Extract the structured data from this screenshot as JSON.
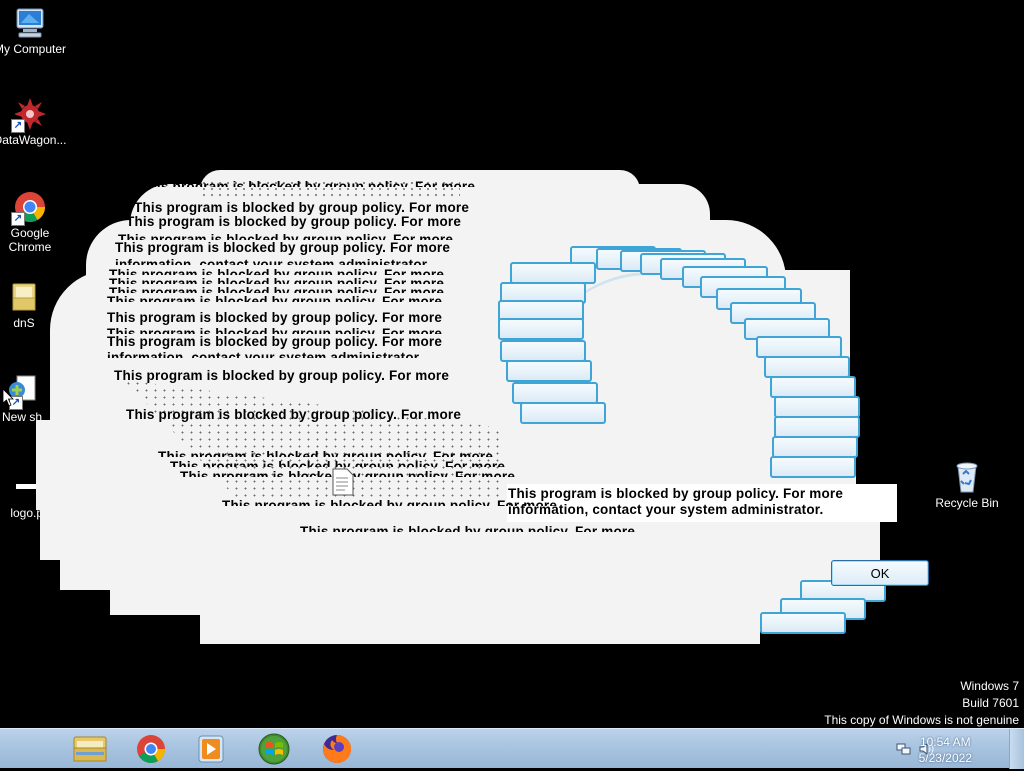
{
  "desktop_icons": [
    {
      "name": "my-computer",
      "label": "My Computer",
      "icon": "computer-icon"
    },
    {
      "name": "datawagon",
      "label": "DataWagon...",
      "icon": "datawagon-icon"
    },
    {
      "name": "google-chrome",
      "label": "Google Chrome",
      "icon": "chrome-icon"
    },
    {
      "name": "dns",
      "label": "dnS",
      "icon": "folder-icon"
    },
    {
      "name": "new-shortcut",
      "label": "New sh",
      "icon": "shortcut-icon"
    },
    {
      "name": "logo-png",
      "label": "logo.pn",
      "icon": "image-file-icon"
    },
    {
      "name": "recycle-bin",
      "label": "Recycle Bin",
      "icon": "recycle-bin-icon"
    }
  ],
  "dialog": {
    "message_line1": "This program is blocked by group policy. For more",
    "message_line2": "information, contact your system administrator.",
    "ok_label": "OK",
    "ghost_line1": "This program is blocked by group policy. For more",
    "ghost_line2": "information, contact your system administrator"
  },
  "watermark": {
    "line1": "Windows 7",
    "line2": "Build 7601",
    "line3": "This copy of Windows is not genuine"
  },
  "taskbar": {
    "pinned": [
      "file-explorer-icon",
      "chrome-icon",
      "media-player-icon",
      "start-icon",
      "firefox-icon"
    ],
    "time": "10:54 AM",
    "date": "5/23/2022"
  },
  "colors": {
    "desktop_bg": "#000000",
    "taskbar_top": "#bcd3ea",
    "button_border": "#3fa4d6"
  }
}
